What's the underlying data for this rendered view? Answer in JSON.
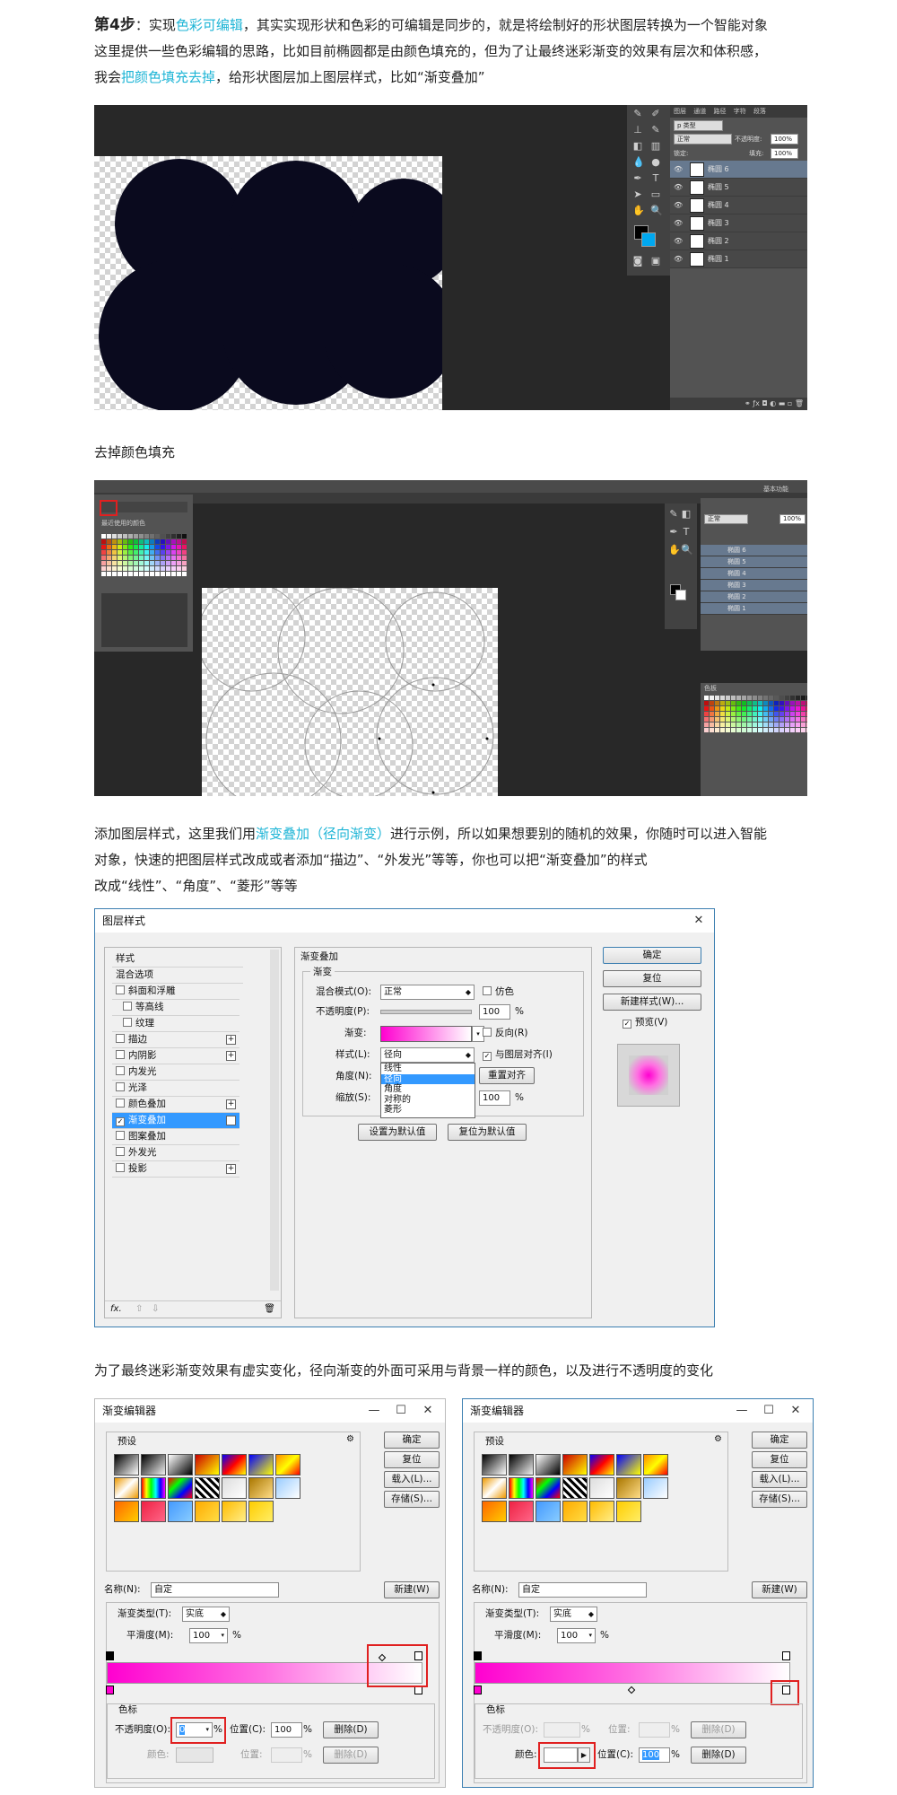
{
  "step": {
    "label": "第4步",
    "colon": "：实现",
    "highlight1": "色彩可编辑",
    "line1_rest": "，其实实现形状和色彩的可编辑是同步的，就是将绘制好的形状图层转换为一个智能对象",
    "line2": "这里提供一些色彩编辑的思路，比如目前椭圆都是由颜色填充的，但为了让最终迷彩渐变的效果有层次和体积感，",
    "line3_pre": "我会",
    "highlight2": "把颜色填充去掉",
    "line3_rest": "，给形状图层加上图层样式，比如“渐变叠加”"
  },
  "caption_remove_fill": "去掉颜色填充",
  "para_style": {
    "pre": "添加图层样式，这里我们用",
    "highlight": "渐变叠加（径向渐变）",
    "rest1": "进行示例，所以如果想要别的随机的效果，你随时可以进入智能",
    "line2": "对象，快速的把图层样式改成或者添加“描边”、“外发光”等等，你也可以把“渐变叠加”的样式",
    "line3": "改成“线性”、“角度”、“菱形”等等"
  },
  "para_gradient": "为了最终迷彩渐变效果有虚实变化，径向渐变的外面可采用与背景一样的颜色，以及进行不透明度的变化",
  "ps1": {
    "layers": [
      "椭圆 6",
      "椭圆 5",
      "椭圆 4",
      "椭圆 3",
      "椭圆 2",
      "椭圆 1"
    ],
    "kind_label": "p 类型",
    "mode_label": "正常",
    "opacity_label": "不透明度:",
    "opacity_value": "100%",
    "lock_label": "锁定:",
    "fill_label": "填充:",
    "fill_value": "100%",
    "tabs": [
      "图层",
      "通道",
      "路径",
      "字符",
      "段落"
    ]
  },
  "ps2": {
    "swatch_title": "最近使用的颜色",
    "layers": [
      "椭圆 6",
      "椭圆 5",
      "椭圆 4",
      "椭圆 3",
      "椭圆 2",
      "椭圆 1"
    ],
    "mode_label": "正常",
    "opacity_value": "100%",
    "swatch_panel_tabs": "色板",
    "essentials": "基本功能"
  },
  "layer_style_dialog": {
    "title": "图层样式",
    "styles": [
      {
        "label": "样式",
        "checkbox": false,
        "plus": false,
        "checked": false
      },
      {
        "label": "混合选项",
        "checkbox": false,
        "plus": false,
        "checked": false
      },
      {
        "label": "斜面和浮雕",
        "checkbox": true,
        "plus": false,
        "checked": false
      },
      {
        "label": "等高线",
        "checkbox": true,
        "plus": false,
        "checked": false,
        "indent": true
      },
      {
        "label": "纹理",
        "checkbox": true,
        "plus": false,
        "checked": false,
        "indent": true
      },
      {
        "label": "描边",
        "checkbox": true,
        "plus": true,
        "checked": false
      },
      {
        "label": "内阴影",
        "checkbox": true,
        "plus": true,
        "checked": false
      },
      {
        "label": "内发光",
        "checkbox": true,
        "plus": false,
        "checked": false
      },
      {
        "label": "光泽",
        "checkbox": true,
        "plus": false,
        "checked": false
      },
      {
        "label": "颜色叠加",
        "checkbox": true,
        "plus": true,
        "checked": false
      },
      {
        "label": "渐变叠加",
        "checkbox": true,
        "plus": true,
        "checked": true,
        "selected": true
      },
      {
        "label": "图案叠加",
        "checkbox": true,
        "plus": false,
        "checked": false
      },
      {
        "label": "外发光",
        "checkbox": true,
        "plus": false,
        "checked": false
      },
      {
        "label": "投影",
        "checkbox": true,
        "plus": true,
        "checked": false
      }
    ],
    "section_title": "渐变叠加",
    "sub_title": "渐变",
    "blend_mode_label": "混合模式(O):",
    "blend_mode_value": "正常",
    "dither_label": "仿色",
    "opacity_label": "不透明度(P):",
    "opacity_value": "100",
    "percent": "%",
    "gradient_label": "渐变:",
    "reverse_label": "反向(R)",
    "style_label": "样式(L):",
    "style_value": "径向",
    "align_label": "与图层对齐(I)",
    "angle_label": "角度(N):",
    "reset_align": "重置对齐",
    "scale_label": "缩放(S):",
    "scale_value": "100",
    "style_options": [
      "线性",
      "径向",
      "角度",
      "对称的",
      "菱形"
    ],
    "set_default": "设置为默认值",
    "reset_default": "复位为默认值",
    "ok": "确定",
    "reset": "复位",
    "new_style": "新建样式(W)...",
    "preview": "预览(V)",
    "fx": "fx."
  },
  "gradient_editor": {
    "title": "渐变编辑器",
    "presets": "预设",
    "ok": "确定",
    "reset": "复位",
    "load": "载入(L)...",
    "save": "存储(S)...",
    "name_label": "名称(N):",
    "name_value": "自定",
    "new": "新建(W)",
    "type_label": "渐变类型(T):",
    "type_value": "实底",
    "smooth_label": "平滑度(M):",
    "smooth_value": "100",
    "percent": "%",
    "stops_title": "色标",
    "opacity_label": "不透明度(O):",
    "opacity_value_left": "0",
    "location_label": "位置(C):",
    "location_value": "100",
    "delete": "删除(D)",
    "color_label": "颜色:",
    "location_label2": "位置:"
  }
}
